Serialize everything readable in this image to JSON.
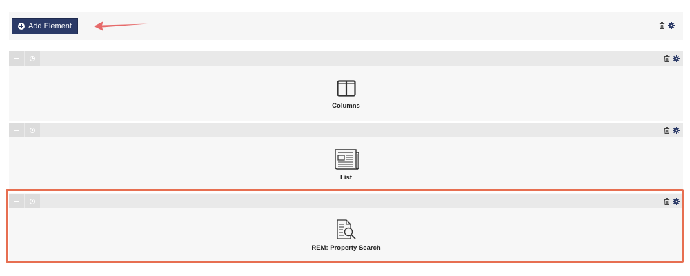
{
  "toolbar": {
    "add_element_label": "Add Element"
  },
  "rows": [
    {
      "element_name": "Columns",
      "icon": "columns-icon"
    },
    {
      "element_name": "List",
      "icon": "list-icon"
    },
    {
      "element_name": "REM: Property Search",
      "icon": "property-search-icon"
    }
  ],
  "colors": {
    "button": "#2b3a67",
    "highlight": "#e76f51",
    "arrow": "#e66a6a"
  }
}
